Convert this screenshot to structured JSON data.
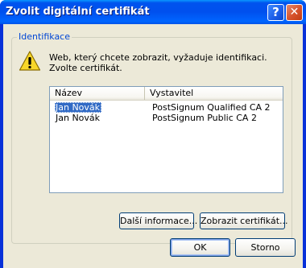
{
  "window": {
    "title": "Zvolit digitální certifikát"
  },
  "titlebar": {
    "help_glyph": "?",
    "close_glyph": "✕"
  },
  "group": {
    "legend": "Identifikace",
    "message_line1": "Web, který chcete zobrazit, vyžaduje identifikaci.",
    "message_line2": "Zvolte certifikát."
  },
  "list": {
    "columns": [
      "Název",
      "Vystavitel"
    ],
    "rows": [
      {
        "name": "Jan Novák",
        "issuer": "PostSignum Qualified CA 2",
        "selected": true
      },
      {
        "name": "Jan Novák",
        "issuer": "PostSignum Public CA 2",
        "selected": false
      }
    ]
  },
  "buttons": {
    "more_info": "Další informace...",
    "view_cert": "Zobrazit certifikát...",
    "ok": "OK",
    "cancel": "Storno"
  },
  "icons": {
    "warning": "warning-icon"
  },
  "colors": {
    "titlebar": "#0054e3",
    "selection": "#316ac5",
    "legend": "#0046d5",
    "dialog_bg": "#ece9d8"
  }
}
